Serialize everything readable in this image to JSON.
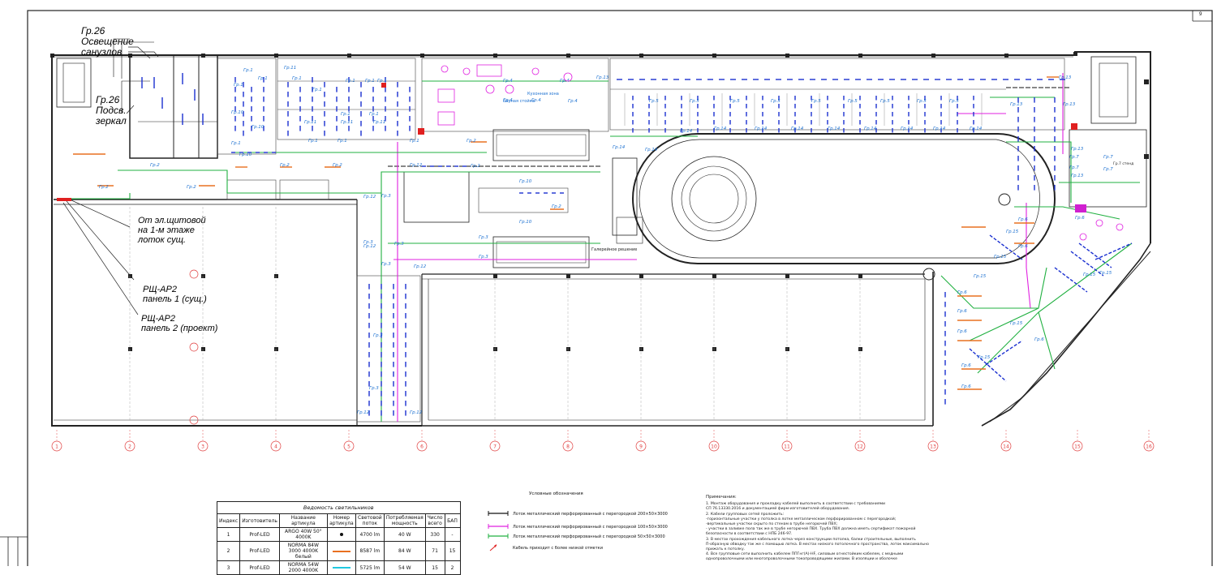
{
  "sheet_number": "9",
  "callouts": {
    "sanuzly": [
      "Гр.26",
      "Освещение",
      "санузлов"
    ],
    "mirrors": [
      "Гр.26",
      "Подсв.",
      "зеркал"
    ],
    "cable_from": [
      "От эл.щитовой",
      "на 1-м этаже",
      "лоток сущ."
    ],
    "panel1": [
      "РЩ-АР2",
      "панель 1 (сущ.)"
    ],
    "panel2": [
      "РЩ-АР2",
      "панель 2 (проект)"
    ]
  },
  "plan_labels": {
    "groups": [
      "Гр.1",
      "Гр.2",
      "Гр.3",
      "Гр.4",
      "Гр.5",
      "Гр.6",
      "Гр.7",
      "Гр.10",
      "Гр.11",
      "Гр.12",
      "Гр.13",
      "Гр.14",
      "Гр.15"
    ],
    "kitchen": "Кухонная зона",
    "bar": "Барная стойка",
    "gallery": "Галерейное решение",
    "stair_note": "Гр.7 стенд"
  },
  "axes": [
    "1",
    "2",
    "3",
    "4",
    "5",
    "6",
    "7",
    "8",
    "9",
    "10",
    "11",
    "12",
    "13",
    "14",
    "15",
    "16"
  ],
  "luminaires_table": {
    "caption": "Ведомость светильников",
    "headers": [
      "Индекс",
      "Изготовитель",
      "Название артикула",
      "Номер артикула",
      "Световой поток",
      "Потребляемая мощность",
      "Число всего",
      "БАП"
    ],
    "rows": [
      {
        "index": "1",
        "maker": "Prof-LED",
        "name": "ARGO 40W 50° 4000K",
        "number_symbol": "dot",
        "flux": "4700 lm",
        "power": "40 W",
        "qty": "330",
        "bap": "-"
      },
      {
        "index": "2",
        "maker": "Prof-LED",
        "name": "NORMA 84W 3000 4000K белый",
        "number_symbol": "orange-line",
        "flux": "8587 lm",
        "power": "84 W",
        "qty": "71",
        "bap": "15"
      },
      {
        "index": "3",
        "maker": "Prof-LED",
        "name": "NORMA 54W 2000 4000K",
        "number_symbol": "cyan-line",
        "flux": "5725 lm",
        "power": "54 W",
        "qty": "15",
        "bap": "2"
      }
    ]
  },
  "legend": {
    "title": "Условные обозначения",
    "items": [
      {
        "symbol": "tray-black",
        "color": "#111111",
        "text": "Лоток металлический перфорированный с перегородкой 200×50×3000"
      },
      {
        "symbol": "tray-magenta",
        "color": "#e020e0",
        "text": "Лоток металлический перфорированный с перегородкой 100×50×3000"
      },
      {
        "symbol": "tray-green",
        "color": "#20b040",
        "text": "Лоток металлический перфорированный с перегородкой 50×50×3000"
      },
      {
        "symbol": "arrow-red",
        "color": "#e02020",
        "text": "Кабель приходит с более низкой отметки"
      }
    ]
  },
  "notes": {
    "title": "Примечания:",
    "lines": [
      "1.       Монтаж оборудования и прокладку кабелей выполнить в соответствии с требованиями",
      "СП 76.13330.2016 и документацией фирм-изготовителей оборудования.",
      "2.       Кабели групповых сетей проложить:",
      "-горизонтальные участки у потолка в лотке металлическом перфорированном с перегородкой;",
      "-вертикальные участки скрыто по стенам в трубе негорючей ПВХ;",
      "- участки в заливке пола так же в трубе негорючей ПВХ. Труба ПВХ должна иметь сертификат пожарной",
      "безопасности в соответствии с НПБ 246-97.",
      "3.       В местах прохождения кабельного лотка через конструкции потолка, балки строительные, выполнить",
      "П-образную обводку так же с помощью лотка. В местах низкого потолочного пространства, лоток максимально",
      "прижать к потолку.",
      "4.       Все групповые сети выполнить кабелем ППГнг(А)-HF, силовым огнестойким кабелем, с медными",
      "однопроволочными или многопроволочными токопроводящими жилами.  В изоляции и оболочке"
    ]
  },
  "colors": {
    "wall": "#222222",
    "luminaire_blue": "#1a2fd0",
    "label_blue": "#1a6fd0",
    "orange": "#e87020",
    "green": "#20b040",
    "magenta": "#e020e0",
    "red": "#e02020",
    "axis_red": "#e04040"
  }
}
